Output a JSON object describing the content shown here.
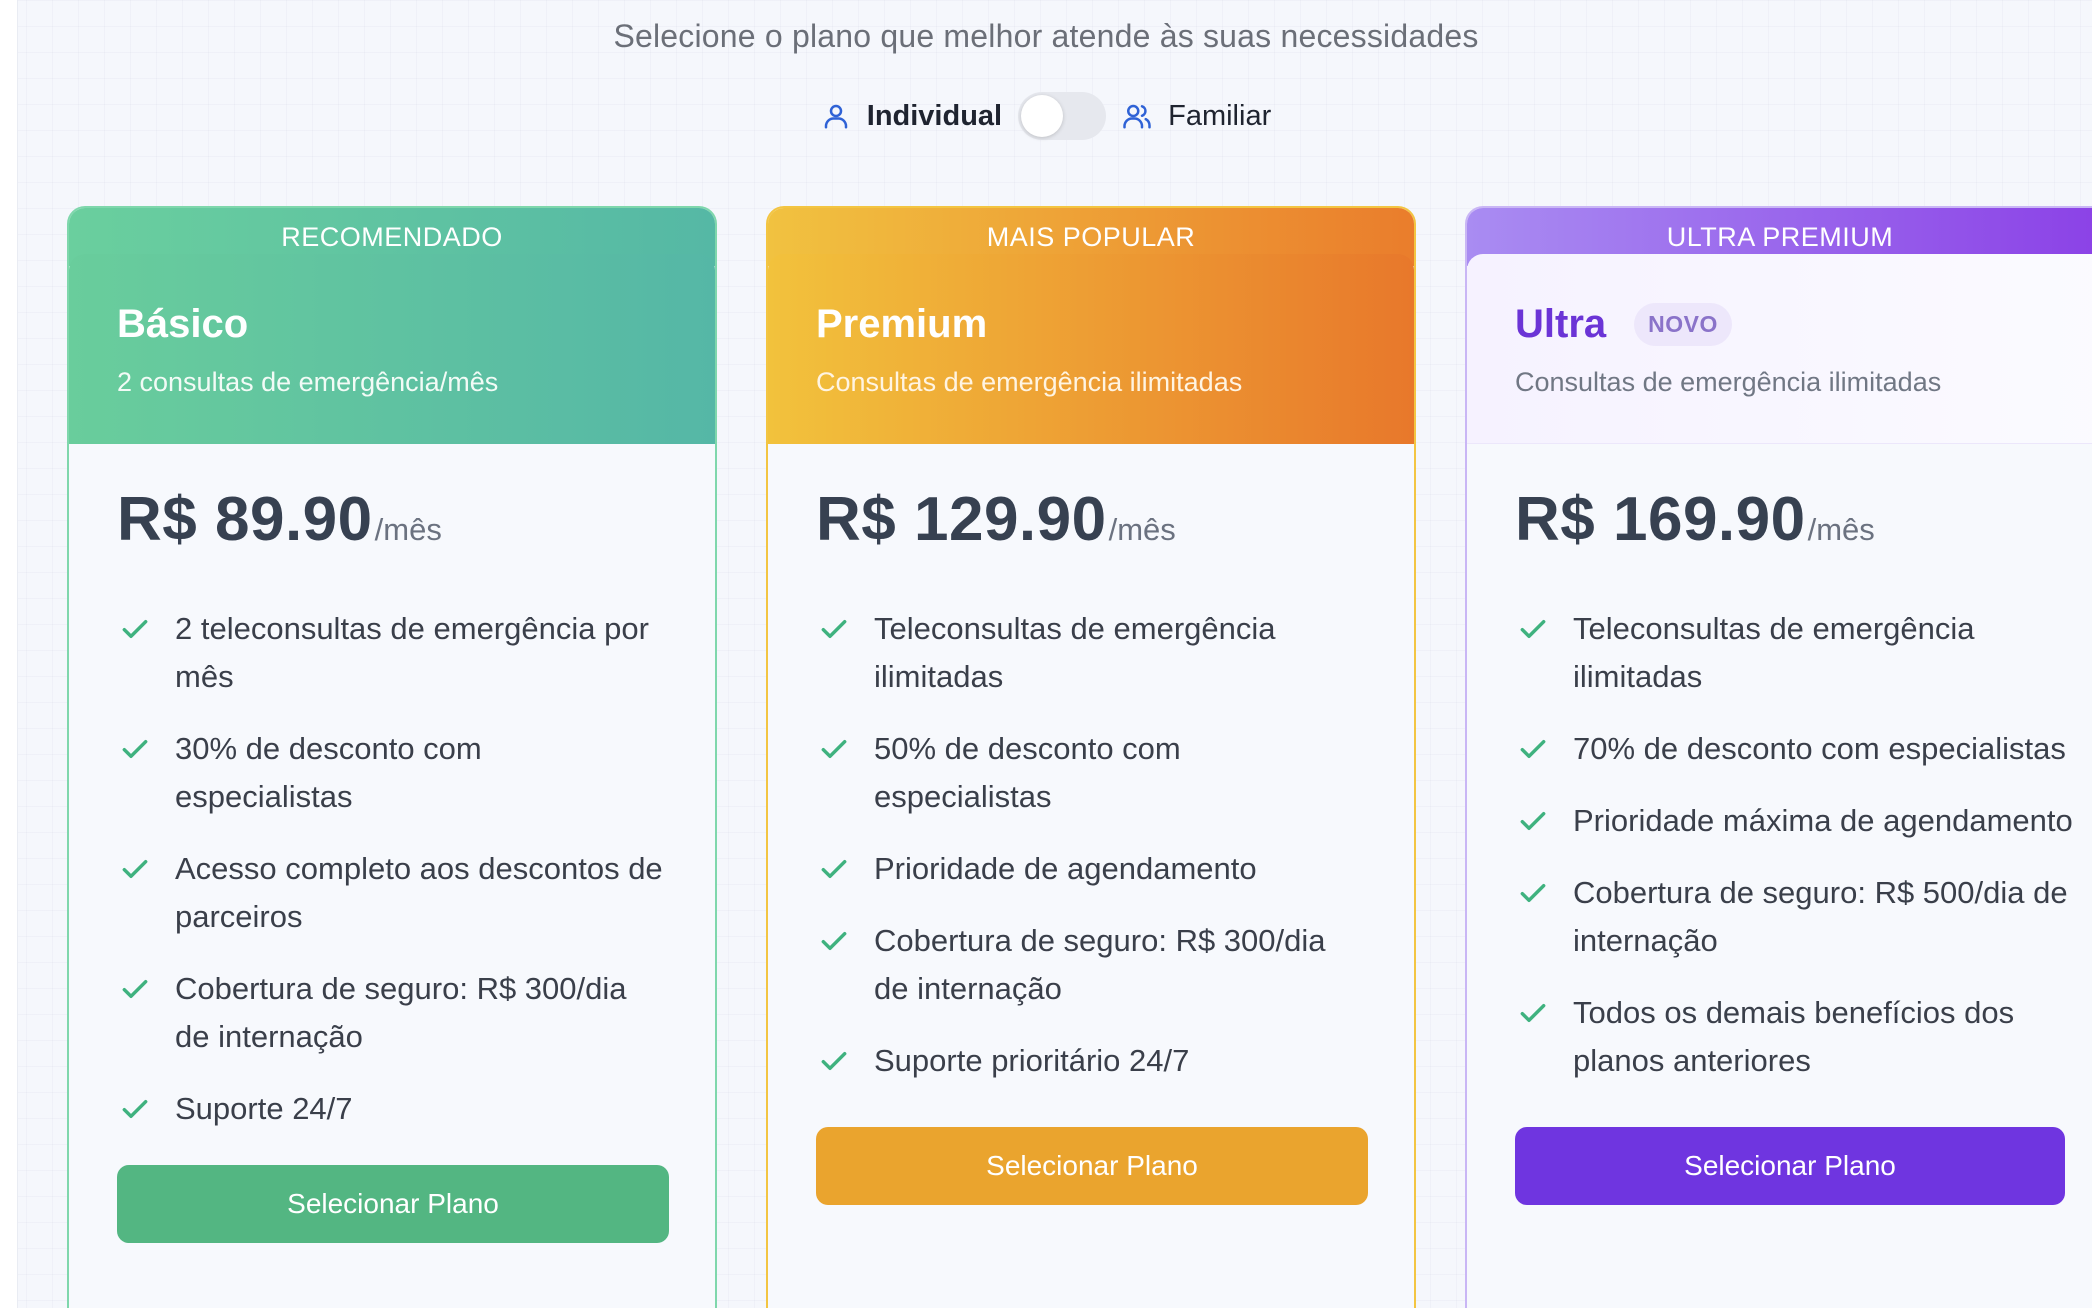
{
  "header": {
    "subtitle": "Selecione o plano que melhor atende às suas necessidades"
  },
  "toggle": {
    "individual_label": "Individual",
    "familiar_label": "Familiar",
    "selected": "Individual"
  },
  "plans": [
    {
      "ribbon": "RECOMENDADO",
      "name": "Básico",
      "description": "2 consultas de emergência/mês",
      "price": "R$ 89.90",
      "period": "/mês",
      "features": [
        "2 teleconsultas de emergência por mês",
        "30% de desconto com especialistas",
        "Acesso completo aos descontos de parceiros",
        "Cobertura de seguro: R$ 300/dia de internação",
        "Suporte 24/7"
      ],
      "button": "Selecionar Plano",
      "accent": "#53b682"
    },
    {
      "ribbon": "MAIS POPULAR",
      "name": "Premium",
      "description": "Consultas de emergência ilimitadas",
      "price": "R$ 129.90",
      "period": "/mês",
      "features": [
        "Teleconsultas de emergência ilimitadas",
        "50% de desconto com especialistas",
        "Prioridade de agendamento",
        "Cobertura de seguro: R$ 300/dia de internação",
        "Suporte prioritário 24/7"
      ],
      "button": "Selecionar Plano",
      "accent": "#eaa42e"
    },
    {
      "ribbon": "ULTRA PREMIUM",
      "name": "Ultra",
      "badge": "NOVO",
      "description": "Consultas de emergência ilimitadas",
      "price": "R$ 169.90",
      "period": "/mês",
      "features": [
        "Teleconsultas de emergência ilimitadas",
        "70% de desconto com especialistas",
        "Prioridade máxima de agendamento",
        "Cobertura de seguro: R$ 500/dia de internação",
        "Todos os demais benefícios dos planos anteriores"
      ],
      "button": "Selecionar Plano",
      "accent": "#6f35e0"
    }
  ],
  "icons": {
    "individual": "user-icon",
    "familiar": "users-icon",
    "feature": "check-icon"
  },
  "colors": {
    "check": "#3fb27f",
    "toggle_icon": "#2f62d6"
  }
}
